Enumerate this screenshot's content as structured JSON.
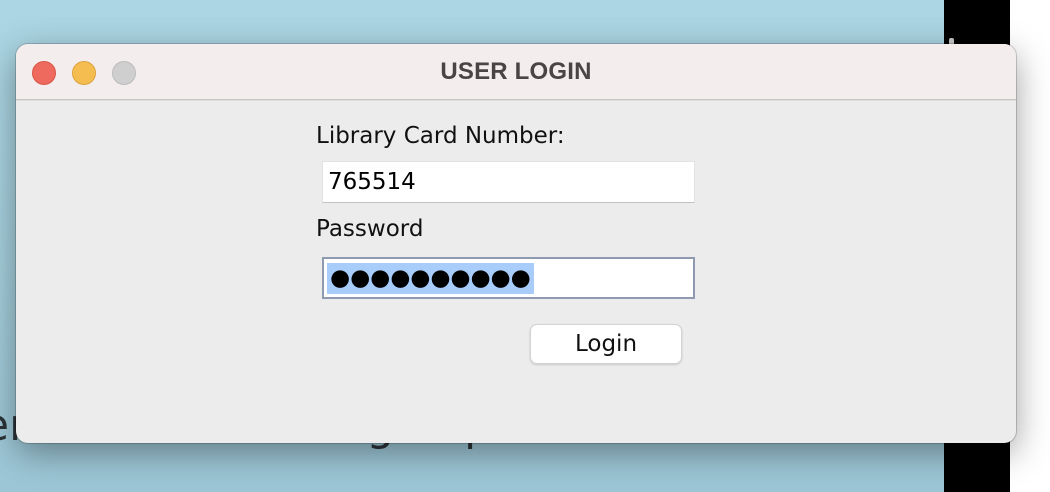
{
  "background": {
    "text": "er Click here to sign up.",
    "colors": {
      "desktop": "#a9d3e0",
      "strip_dark": "#000000",
      "strip_light": "#ffffff"
    }
  },
  "window": {
    "title": "USER LOGIN",
    "controls": {
      "close_color": "#ee6a5f",
      "minimize_color": "#f5bd4f",
      "maximize_color": "#d0cfcf"
    }
  },
  "form": {
    "card_label": "Library Card Number:",
    "card_value": "765514",
    "password_label": "Password",
    "password_masked": "●●●●●●●●●●",
    "password_selected": true,
    "selection_color": "#a9cdfb",
    "login_label": "Login"
  }
}
